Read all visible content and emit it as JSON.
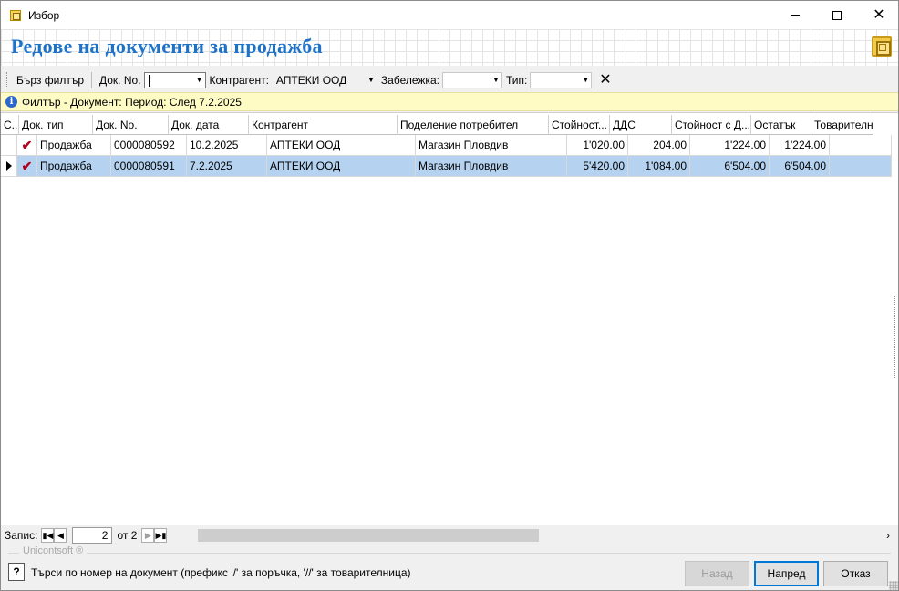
{
  "window": {
    "title": "Избор"
  },
  "header": {
    "title": "Редове на документи за продажба"
  },
  "toolbar": {
    "quick_filter": "Бърз филтър",
    "doc_no_label": "Док. No.",
    "doc_no_value": "",
    "contragent_label": "Контрагент:",
    "contragent_value": "АПТЕКИ ООД",
    "note_label": "Забележка:",
    "note_value": "",
    "type_label": "Тип:",
    "type_value": ""
  },
  "info": {
    "text": "Филтър - Документ: Период: След 7.2.2025"
  },
  "grid": {
    "columns": [
      "С...",
      "Док. тип",
      "Док. No.",
      "Док. дата",
      "Контрагент",
      "Поделение потребител",
      "Стойност...",
      "ДДС",
      "Стойност с Д...",
      "Остатък",
      "Товарителн..."
    ],
    "rows": [
      {
        "checked": true,
        "doc_type": "Продажба",
        "doc_no": "0000080592",
        "doc_date": "10.2.2025",
        "contragent": "АПТЕКИ ООД",
        "division": "Магазин Пловдив",
        "amount": "1'020.00",
        "vat": "204.00",
        "amount_vat": "1'224.00",
        "remainder": "1'224.00",
        "waybill": ""
      },
      {
        "checked": true,
        "doc_type": "Продажба",
        "doc_no": "0000080591",
        "doc_date": "7.2.2025",
        "contragent": "АПТЕКИ ООД",
        "division": "Магазин Пловдив",
        "amount": "5'420.00",
        "vat": "1'084.00",
        "amount_vat": "6'504.00",
        "remainder": "6'504.00",
        "waybill": ""
      }
    ]
  },
  "navigator": {
    "label": "Запис:",
    "current": "2",
    "of_label": "от 2"
  },
  "footer": {
    "brand": "Unicontsoft ®",
    "hint": "Търси по номер на документ (префикс '/' за поръчка, '//' за товарителница)",
    "back": "Назад",
    "next": "Напред",
    "cancel": "Отказ"
  }
}
